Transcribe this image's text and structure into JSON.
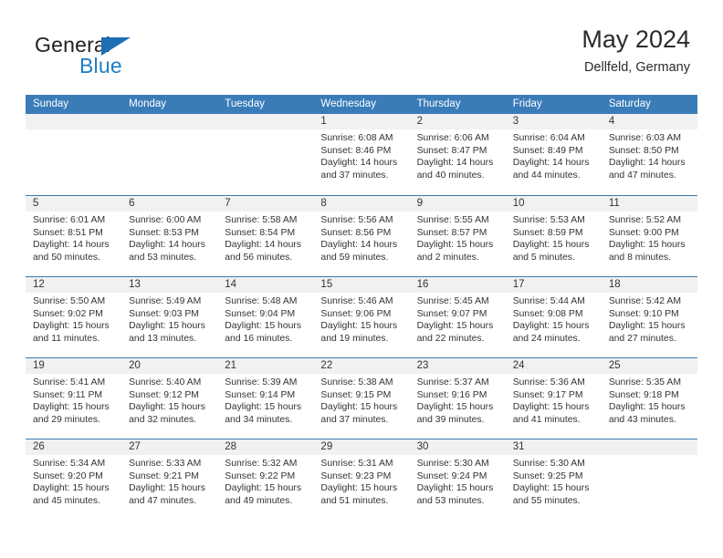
{
  "brand": {
    "name_top": "General",
    "name_bottom": "Blue"
  },
  "header": {
    "title": "May 2024",
    "subtitle": "Dellfeld, Germany"
  },
  "colors": {
    "header_blue": "#3a7cb8",
    "brand_blue": "#1f7ec4",
    "daynum_band": "#f1f1f1"
  },
  "weekdays": [
    "Sunday",
    "Monday",
    "Tuesday",
    "Wednesday",
    "Thursday",
    "Friday",
    "Saturday"
  ],
  "labels": {
    "sunrise_prefix": "Sunrise:",
    "sunset_prefix": "Sunset:",
    "daylight_prefix": "Daylight:"
  },
  "weeks": [
    [
      {
        "day": "",
        "empty": true
      },
      {
        "day": "",
        "empty": true
      },
      {
        "day": "",
        "empty": true
      },
      {
        "day": "1",
        "sunrise": "Sunrise: 6:08 AM",
        "sunset": "Sunset: 8:46 PM",
        "daylight_1": "Daylight: 14 hours",
        "daylight_2": "and 37 minutes."
      },
      {
        "day": "2",
        "sunrise": "Sunrise: 6:06 AM",
        "sunset": "Sunset: 8:47 PM",
        "daylight_1": "Daylight: 14 hours",
        "daylight_2": "and 40 minutes."
      },
      {
        "day": "3",
        "sunrise": "Sunrise: 6:04 AM",
        "sunset": "Sunset: 8:49 PM",
        "daylight_1": "Daylight: 14 hours",
        "daylight_2": "and 44 minutes."
      },
      {
        "day": "4",
        "sunrise": "Sunrise: 6:03 AM",
        "sunset": "Sunset: 8:50 PM",
        "daylight_1": "Daylight: 14 hours",
        "daylight_2": "and 47 minutes."
      }
    ],
    [
      {
        "day": "5",
        "sunrise": "Sunrise: 6:01 AM",
        "sunset": "Sunset: 8:51 PM",
        "daylight_1": "Daylight: 14 hours",
        "daylight_2": "and 50 minutes."
      },
      {
        "day": "6",
        "sunrise": "Sunrise: 6:00 AM",
        "sunset": "Sunset: 8:53 PM",
        "daylight_1": "Daylight: 14 hours",
        "daylight_2": "and 53 minutes."
      },
      {
        "day": "7",
        "sunrise": "Sunrise: 5:58 AM",
        "sunset": "Sunset: 8:54 PM",
        "daylight_1": "Daylight: 14 hours",
        "daylight_2": "and 56 minutes."
      },
      {
        "day": "8",
        "sunrise": "Sunrise: 5:56 AM",
        "sunset": "Sunset: 8:56 PM",
        "daylight_1": "Daylight: 14 hours",
        "daylight_2": "and 59 minutes."
      },
      {
        "day": "9",
        "sunrise": "Sunrise: 5:55 AM",
        "sunset": "Sunset: 8:57 PM",
        "daylight_1": "Daylight: 15 hours",
        "daylight_2": "and 2 minutes."
      },
      {
        "day": "10",
        "sunrise": "Sunrise: 5:53 AM",
        "sunset": "Sunset: 8:59 PM",
        "daylight_1": "Daylight: 15 hours",
        "daylight_2": "and 5 minutes."
      },
      {
        "day": "11",
        "sunrise": "Sunrise: 5:52 AM",
        "sunset": "Sunset: 9:00 PM",
        "daylight_1": "Daylight: 15 hours",
        "daylight_2": "and 8 minutes."
      }
    ],
    [
      {
        "day": "12",
        "sunrise": "Sunrise: 5:50 AM",
        "sunset": "Sunset: 9:02 PM",
        "daylight_1": "Daylight: 15 hours",
        "daylight_2": "and 11 minutes."
      },
      {
        "day": "13",
        "sunrise": "Sunrise: 5:49 AM",
        "sunset": "Sunset: 9:03 PM",
        "daylight_1": "Daylight: 15 hours",
        "daylight_2": "and 13 minutes."
      },
      {
        "day": "14",
        "sunrise": "Sunrise: 5:48 AM",
        "sunset": "Sunset: 9:04 PM",
        "daylight_1": "Daylight: 15 hours",
        "daylight_2": "and 16 minutes."
      },
      {
        "day": "15",
        "sunrise": "Sunrise: 5:46 AM",
        "sunset": "Sunset: 9:06 PM",
        "daylight_1": "Daylight: 15 hours",
        "daylight_2": "and 19 minutes."
      },
      {
        "day": "16",
        "sunrise": "Sunrise: 5:45 AM",
        "sunset": "Sunset: 9:07 PM",
        "daylight_1": "Daylight: 15 hours",
        "daylight_2": "and 22 minutes."
      },
      {
        "day": "17",
        "sunrise": "Sunrise: 5:44 AM",
        "sunset": "Sunset: 9:08 PM",
        "daylight_1": "Daylight: 15 hours",
        "daylight_2": "and 24 minutes."
      },
      {
        "day": "18",
        "sunrise": "Sunrise: 5:42 AM",
        "sunset": "Sunset: 9:10 PM",
        "daylight_1": "Daylight: 15 hours",
        "daylight_2": "and 27 minutes."
      }
    ],
    [
      {
        "day": "19",
        "sunrise": "Sunrise: 5:41 AM",
        "sunset": "Sunset: 9:11 PM",
        "daylight_1": "Daylight: 15 hours",
        "daylight_2": "and 29 minutes."
      },
      {
        "day": "20",
        "sunrise": "Sunrise: 5:40 AM",
        "sunset": "Sunset: 9:12 PM",
        "daylight_1": "Daylight: 15 hours",
        "daylight_2": "and 32 minutes."
      },
      {
        "day": "21",
        "sunrise": "Sunrise: 5:39 AM",
        "sunset": "Sunset: 9:14 PM",
        "daylight_1": "Daylight: 15 hours",
        "daylight_2": "and 34 minutes."
      },
      {
        "day": "22",
        "sunrise": "Sunrise: 5:38 AM",
        "sunset": "Sunset: 9:15 PM",
        "daylight_1": "Daylight: 15 hours",
        "daylight_2": "and 37 minutes."
      },
      {
        "day": "23",
        "sunrise": "Sunrise: 5:37 AM",
        "sunset": "Sunset: 9:16 PM",
        "daylight_1": "Daylight: 15 hours",
        "daylight_2": "and 39 minutes."
      },
      {
        "day": "24",
        "sunrise": "Sunrise: 5:36 AM",
        "sunset": "Sunset: 9:17 PM",
        "daylight_1": "Daylight: 15 hours",
        "daylight_2": "and 41 minutes."
      },
      {
        "day": "25",
        "sunrise": "Sunrise: 5:35 AM",
        "sunset": "Sunset: 9:18 PM",
        "daylight_1": "Daylight: 15 hours",
        "daylight_2": "and 43 minutes."
      }
    ],
    [
      {
        "day": "26",
        "sunrise": "Sunrise: 5:34 AM",
        "sunset": "Sunset: 9:20 PM",
        "daylight_1": "Daylight: 15 hours",
        "daylight_2": "and 45 minutes."
      },
      {
        "day": "27",
        "sunrise": "Sunrise: 5:33 AM",
        "sunset": "Sunset: 9:21 PM",
        "daylight_1": "Daylight: 15 hours",
        "daylight_2": "and 47 minutes."
      },
      {
        "day": "28",
        "sunrise": "Sunrise: 5:32 AM",
        "sunset": "Sunset: 9:22 PM",
        "daylight_1": "Daylight: 15 hours",
        "daylight_2": "and 49 minutes."
      },
      {
        "day": "29",
        "sunrise": "Sunrise: 5:31 AM",
        "sunset": "Sunset: 9:23 PM",
        "daylight_1": "Daylight: 15 hours",
        "daylight_2": "and 51 minutes."
      },
      {
        "day": "30",
        "sunrise": "Sunrise: 5:30 AM",
        "sunset": "Sunset: 9:24 PM",
        "daylight_1": "Daylight: 15 hours",
        "daylight_2": "and 53 minutes."
      },
      {
        "day": "31",
        "sunrise": "Sunrise: 5:30 AM",
        "sunset": "Sunset: 9:25 PM",
        "daylight_1": "Daylight: 15 hours",
        "daylight_2": "and 55 minutes."
      },
      {
        "day": "",
        "empty": true
      }
    ]
  ]
}
